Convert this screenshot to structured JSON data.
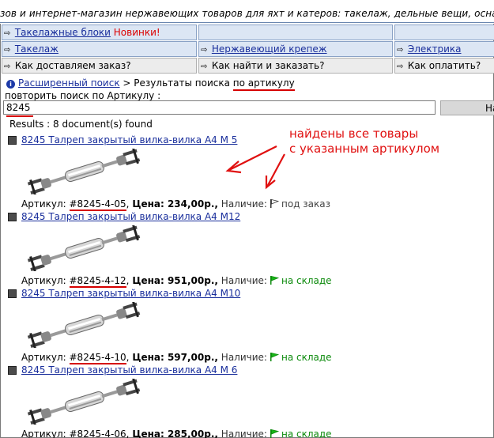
{
  "banner": {
    "text": "зов и интернет-магазин нержавеющих товаров для яхт и катеров: такелаж, дельные вещи, оснастка и к"
  },
  "nav": {
    "row1": [
      {
        "label": "Такелажные блоки",
        "badge": "Новинки!"
      },
      {
        "label": ""
      },
      {
        "label": ""
      }
    ],
    "row2": [
      {
        "label": "Такелаж"
      },
      {
        "label": "Нержавеющий крепеж"
      },
      {
        "label": "Электрика"
      }
    ],
    "row3": [
      {
        "label": "Как доставляем заказ?"
      },
      {
        "label": "Как найти и заказать?"
      },
      {
        "label": "Как оплатить?"
      }
    ]
  },
  "breadcrumb": {
    "link": "Расширенный поиск",
    "separator": ">",
    "text": "Результаты поиска",
    "by_label": "по артикулу"
  },
  "search": {
    "label": "повторить поиск по Артикулу :",
    "value": "8245",
    "button": "На"
  },
  "results": {
    "summary": "Results : 8 document(s) found"
  },
  "annotation": {
    "line1": "найдены все товары",
    "line2": "с указанным артикулом"
  },
  "items": [
    {
      "title": "8245 Талреп закрытый вилка-вилка А4 М 5",
      "article_label": "Артикул: ",
      "article": "#8245-4-05",
      "price_label": "Цена: 234,00р.,",
      "avail_label": "Наличие:",
      "avail": "под заказ",
      "avail_type": "order"
    },
    {
      "title": "8245 Талреп закрытый вилка-вилка А4 М12",
      "article_label": "Артикул: ",
      "article": "#8245-4-12",
      "price_label": "Цена: 951,00р.,",
      "avail_label": "Наличие:",
      "avail": "на складе",
      "avail_type": "stock"
    },
    {
      "title": "8245 Талреп закрытый вилка-вилка А4 М10",
      "article_label": "Артикул: ",
      "article": "#8245-4-10",
      "price_label": "Цена: 597,00р.,",
      "avail_label": "Наличие:",
      "avail": "на складе",
      "avail_type": "stock"
    },
    {
      "title": "8245 Талреп закрытый вилка-вилка А4 М 6",
      "article_label": "Артикул: ",
      "article": "#8245-4-06",
      "price_label": "Цена: 285,00р.,",
      "avail_label": "Наличие:",
      "avail": "на складе",
      "avail_type": "stock"
    }
  ],
  "colors": {
    "link": "#1a2f9c",
    "accent_red": "#d60000",
    "stock_green": "#0c8a0c",
    "nav_bg": "#dce6f4"
  }
}
